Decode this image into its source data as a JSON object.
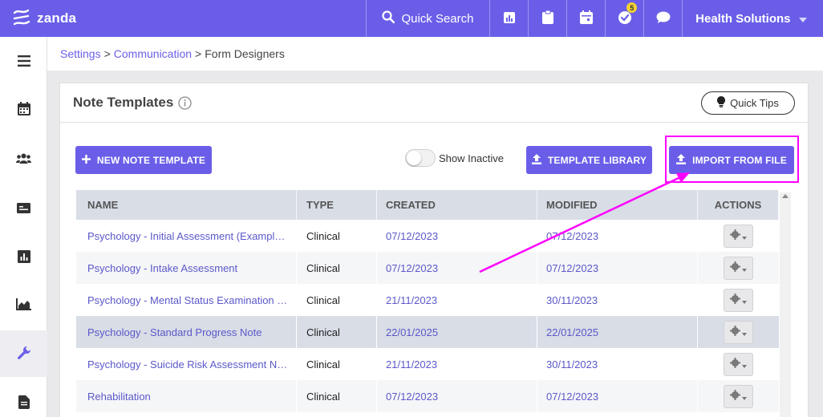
{
  "app": {
    "logo_text": "zanda",
    "brand_color": "#6a5ee8"
  },
  "topbar": {
    "search_label": "Quick Search",
    "icons": [
      "reports-icon",
      "clipboard-icon",
      "calendar-icon",
      "tasks-icon",
      "chat-icon"
    ],
    "tasks_badge": "5",
    "org_name": "Health Solutions"
  },
  "sidebar": {
    "items": [
      "menu-icon",
      "calendar-icon",
      "contacts-icon",
      "card-icon",
      "reports-icon",
      "analytics-icon",
      "settings-wrench-icon",
      "document-icon"
    ],
    "active": "settings-wrench-icon"
  },
  "breadcrumb": {
    "item1": "Settings",
    "sep": ">",
    "item2": "Communication",
    "current": "Form Designers"
  },
  "panel": {
    "title": "Note Templates",
    "quick_tips_label": "Quick Tips",
    "new_button": "NEW NOTE TEMPLATE",
    "show_inactive_label": "Show Inactive",
    "show_inactive_value": false,
    "library_button": "TEMPLATE LIBRARY",
    "import_button": "IMPORT FROM FILE"
  },
  "table": {
    "headers": {
      "name": "NAME",
      "type": "TYPE",
      "created": "CREATED",
      "modified": "MODIFIED",
      "actions": "ACTIONS"
    },
    "rows": [
      {
        "name": "Psychology - Initial Assessment (Exampl…",
        "type": "Clinical",
        "created": "07/12/2023",
        "modified": "07/12/2023"
      },
      {
        "name": "Psychology - Intake Assessment",
        "type": "Clinical",
        "created": "07/12/2023",
        "modified": "07/12/2023"
      },
      {
        "name": "Psychology - Mental Status Examination …",
        "type": "Clinical",
        "created": "21/11/2023",
        "modified": "30/11/2023"
      },
      {
        "name": "Psychology - Standard Progress Note",
        "type": "Clinical",
        "created": "22/01/2025",
        "modified": "22/01/2025"
      },
      {
        "name": "Psychology - Suicide Risk Assessment N…",
        "type": "Clinical",
        "created": "21/11/2023",
        "modified": "30/11/2023"
      },
      {
        "name": "Rehabilitation",
        "type": "Clinical",
        "created": "07/12/2023",
        "modified": "07/12/2023"
      }
    ]
  },
  "annotation": {
    "highlight_color": "#ff00ff"
  }
}
